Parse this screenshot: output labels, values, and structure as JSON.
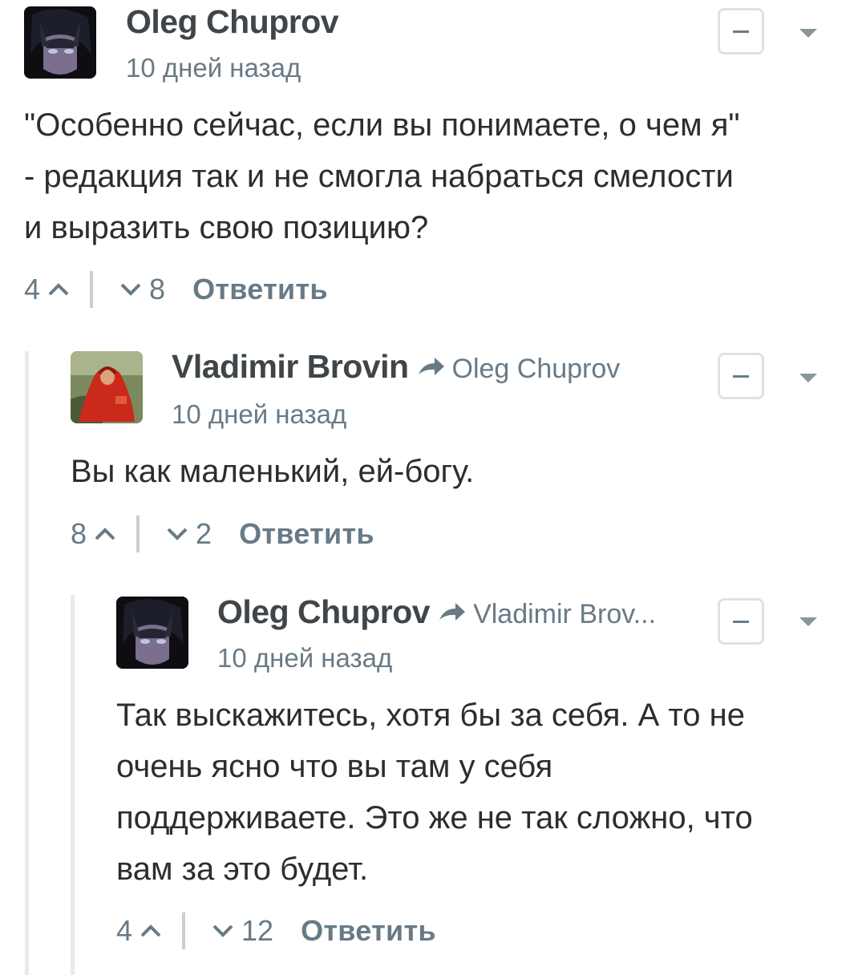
{
  "comments": [
    {
      "author": "Oleg Chuprov",
      "reply_to": "",
      "time": "10 дней назад",
      "text": [
        "\"Особенно сейчас, если вы понимаете, о чем я\"",
        "- редакция так и не смогла набраться смелости",
        "и выразить свою позицию?"
      ],
      "upvotes": "4",
      "downvotes": "8",
      "reply_label": "Ответить",
      "avatar_icon": "anime-character-avatar"
    },
    {
      "author": "Vladimir Brovin",
      "reply_to": "Oleg Chuprov",
      "time": "10 дней назад",
      "text": [
        "Вы как маленький, ей-богу."
      ],
      "upvotes": "8",
      "downvotes": "2",
      "reply_label": "Ответить",
      "avatar_icon": "red-robed-figure-avatar"
    },
    {
      "author": "Oleg Chuprov",
      "reply_to": "Vladimir Brov...",
      "time": "10 дней назад",
      "text": [
        "Так выскажитесь, хотя бы за себя. А то не",
        "очень ясно что вы там у себя",
        "поддерживаете. Это же не так сложно, что",
        "вам за это будет."
      ],
      "upvotes": "4",
      "downvotes": "12",
      "reply_label": "Ответить",
      "avatar_icon": "anime-character-avatar"
    }
  ],
  "colors": {
    "author": "#3f4549",
    "meta": "#687a86",
    "text": "#2a2e2e",
    "thread_line": "#e7e9eb"
  }
}
